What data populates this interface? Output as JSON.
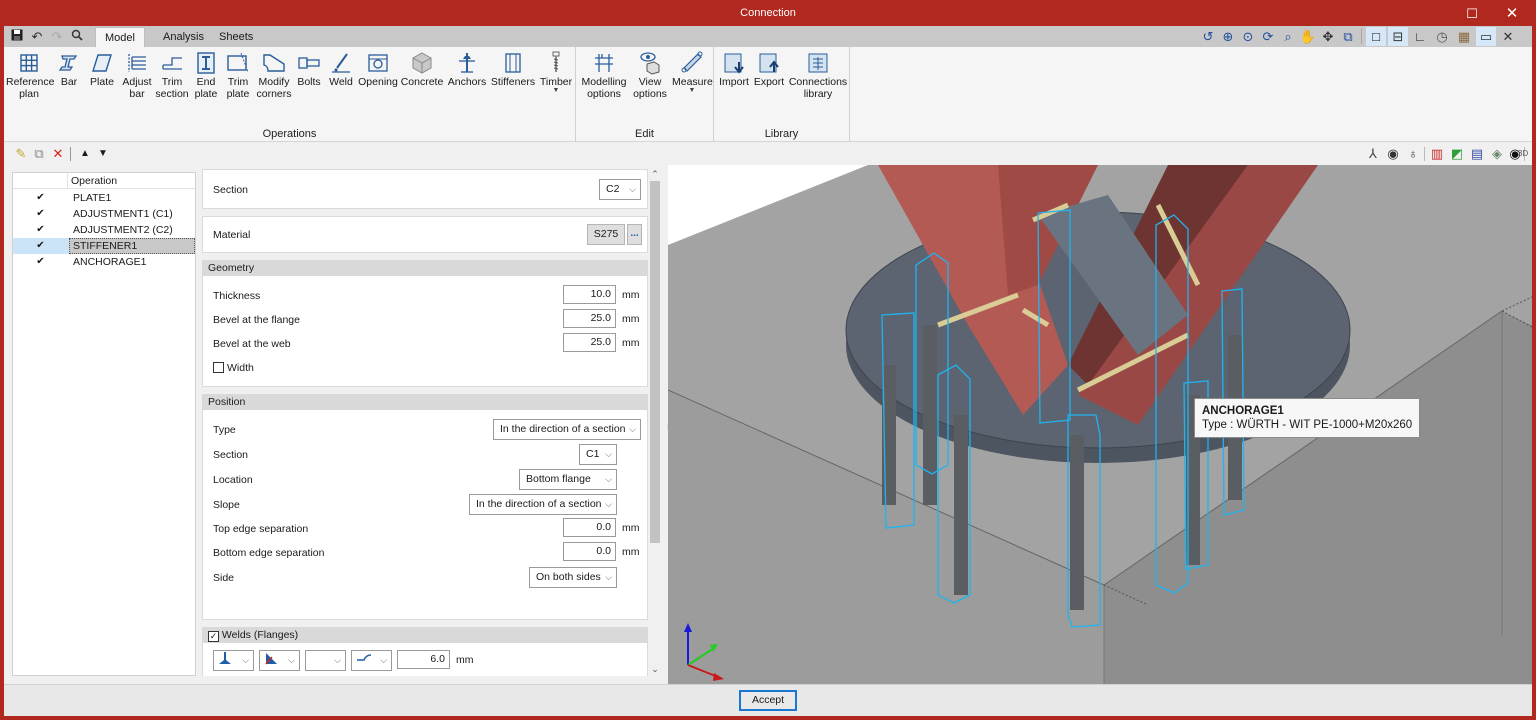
{
  "window": {
    "title": "Connection",
    "maximize_icon": "☐",
    "close_icon": "✕"
  },
  "quick_access": [
    {
      "name": "save-icon",
      "glyph": "💾"
    },
    {
      "name": "undo-icon",
      "glyph": "↶"
    },
    {
      "name": "redo-icon",
      "glyph": "↷"
    },
    {
      "name": "search-icon",
      "glyph": "🔍"
    }
  ],
  "tabs": [
    {
      "label": "Model",
      "active": true
    },
    {
      "label": "Analysis",
      "active": false
    },
    {
      "label": "Sheets",
      "active": false
    }
  ],
  "ribbon": {
    "groups": [
      {
        "label": "Operations",
        "buttons": [
          {
            "label1": "Reference",
            "label2": "plan",
            "icon": "grid-icon"
          },
          {
            "label1": "Bar",
            "label2": "",
            "icon": "i-beam-icon"
          },
          {
            "label1": "Plate",
            "label2": "",
            "icon": "plate-icon"
          },
          {
            "label1": "Adjust",
            "label2": "bar",
            "icon": "adjust-bar-icon"
          },
          {
            "label1": "Trim",
            "label2": "section",
            "icon": "trim-section-icon"
          },
          {
            "label1": "End",
            "label2": "plate",
            "icon": "end-plate-icon"
          },
          {
            "label1": "Trim",
            "label2": "plate",
            "icon": "trim-plate-icon"
          },
          {
            "label1": "Modify",
            "label2": "corners",
            "icon": "modify-corners-icon"
          },
          {
            "label1": "Bolts",
            "label2": "",
            "icon": "bolt-icon"
          },
          {
            "label1": "Weld",
            "label2": "",
            "icon": "weld-icon"
          },
          {
            "label1": "Opening",
            "label2": "",
            "icon": "opening-icon"
          },
          {
            "label1": "Concrete",
            "label2": "",
            "icon": "concrete-icon"
          },
          {
            "label1": "Anchors",
            "label2": "",
            "icon": "anchor-icon"
          },
          {
            "label1": "Stiffeners",
            "label2": "",
            "icon": "stiffener-icon"
          },
          {
            "label1": "Timber",
            "label2": "",
            "icon": "timber-screw-icon",
            "dropdown": true
          }
        ]
      },
      {
        "label": "Edit",
        "buttons": [
          {
            "label1": "Modelling",
            "label2": "options",
            "icon": "modelling-options-icon"
          },
          {
            "label1": "View",
            "label2": "options",
            "icon": "view-options-icon"
          },
          {
            "label1": "Measure",
            "label2": "",
            "icon": "ruler-icon",
            "dropdown": true
          }
        ]
      },
      {
        "label": "Library",
        "buttons": [
          {
            "label1": "Import",
            "label2": "",
            "icon": "import-icon"
          },
          {
            "label1": "Export",
            "label2": "",
            "icon": "export-icon"
          },
          {
            "label1": "Connections",
            "label2": "library",
            "icon": "connections-library-icon"
          }
        ]
      }
    ]
  },
  "view_toolbar_top": [
    {
      "name": "zoom-previous-icon",
      "glyph": "↺"
    },
    {
      "name": "zoom-extents-icon",
      "glyph": "⊕"
    },
    {
      "name": "zoom-x2-icon",
      "glyph": "⊙"
    },
    {
      "name": "regenerate-icon",
      "glyph": "⟳"
    },
    {
      "name": "zoom-window-icon",
      "glyph": "⌕"
    },
    {
      "name": "pan-hand-icon",
      "glyph": "✋"
    },
    {
      "name": "orbit-icon",
      "glyph": "✥"
    },
    {
      "name": "view-window-icon",
      "glyph": "⧉"
    },
    {
      "name": "wireframe-toggle-icon",
      "glyph": "□",
      "on": true
    },
    {
      "name": "dimensions-toggle-icon",
      "glyph": "⊟",
      "on": true
    },
    {
      "name": "angle-icon",
      "glyph": "∟"
    },
    {
      "name": "clock-icon",
      "glyph": "◷"
    },
    {
      "name": "calendar-icon",
      "glyph": "▦"
    },
    {
      "name": "comment-icon",
      "glyph": "▭",
      "on": true
    },
    {
      "name": "tools-icon",
      "glyph": "✕"
    }
  ],
  "list_toolbar": [
    {
      "name": "edit-pencil-icon",
      "glyph": "✎",
      "color": "#c9a227"
    },
    {
      "name": "copy-icon",
      "glyph": "⧉",
      "color": "#8a8a8a"
    },
    {
      "name": "delete-icon",
      "glyph": "✕",
      "color": "#d92020"
    },
    {
      "name": "move-up-icon",
      "glyph": "▲",
      "color": "#222222"
    },
    {
      "name": "move-down-icon",
      "glyph": "▼",
      "color": "#222222"
    }
  ],
  "view_toolbar_right": [
    {
      "name": "axes-icon",
      "glyph": "⅄"
    },
    {
      "name": "rotate-view-icon",
      "glyph": "◉"
    },
    {
      "name": "pivot-icon",
      "glyph": "♁"
    },
    {
      "name": "section-plane-icon",
      "glyph": "▥"
    },
    {
      "name": "clip-plane-icon",
      "glyph": "◩"
    },
    {
      "name": "panel-view-icon",
      "glyph": "▤"
    },
    {
      "name": "layers-icon",
      "glyph": "◈"
    },
    {
      "name": "hide-icon",
      "glyph": "◉"
    },
    {
      "name": "view-3d-icon",
      "glyph": "3D"
    }
  ],
  "operations": {
    "header": "Operation",
    "rows": [
      {
        "name": "PLATE1",
        "checked": true,
        "selected": false
      },
      {
        "name": "ADJUSTMENT1 (C1)",
        "checked": true,
        "selected": false
      },
      {
        "name": "ADJUSTMENT2 (C2)",
        "checked": true,
        "selected": false
      },
      {
        "name": "STIFFENER1",
        "checked": true,
        "selected": true
      },
      {
        "name": "ANCHORAGE1",
        "checked": true,
        "selected": false
      }
    ]
  },
  "properties": {
    "section": {
      "label": "Section",
      "value": "C2"
    },
    "material": {
      "label": "Material",
      "value": "S275",
      "browse": "..."
    },
    "geometry": {
      "header": "Geometry",
      "thickness": {
        "label": "Thickness",
        "value": "10.0",
        "unit": "mm"
      },
      "bevel_flange": {
        "label": "Bevel at the flange",
        "value": "25.0",
        "unit": "mm"
      },
      "bevel_web": {
        "label": "Bevel at the web",
        "value": "25.0",
        "unit": "mm"
      },
      "width": {
        "label": "Width",
        "checked": false
      }
    },
    "position": {
      "header": "Position",
      "type": {
        "label": "Type",
        "value": "In the direction of a section"
      },
      "section": {
        "label": "Section",
        "value": "C1"
      },
      "location": {
        "label": "Location",
        "value": "Bottom flange"
      },
      "slope": {
        "label": "Slope",
        "value": "In the direction of a section"
      },
      "top_sep": {
        "label": "Top edge separation",
        "value": "0.0",
        "unit": "mm"
      },
      "bottom_sep": {
        "label": "Bottom edge separation",
        "value": "0.0",
        "unit": "mm"
      },
      "side": {
        "label": "Side",
        "value": "On both sides"
      }
    },
    "welds": {
      "header": "Welds (Flanges)",
      "checked": true,
      "size": "6.0",
      "unit": "mm"
    }
  },
  "tooltip": {
    "title": "ANCHORAGE1",
    "body": "Type : WÜRTH - WIT PE-1000+M20x260"
  },
  "footer": {
    "accept_label": "Accept"
  },
  "colors": {
    "title_bar": "#b0281e",
    "steel": "#b45a55",
    "plate": "#5b6470",
    "concrete": "#9b9b9b",
    "anchor_outline": "#1fb4f0",
    "weld": "#d9cc94"
  }
}
